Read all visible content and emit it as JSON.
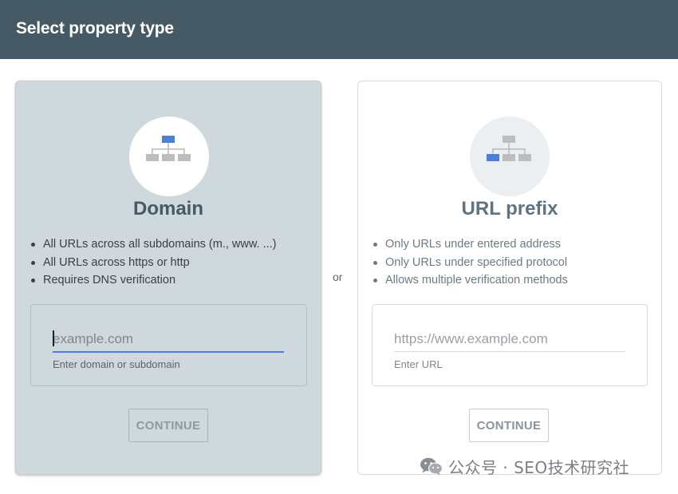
{
  "header": {
    "title": "Select property type"
  },
  "separator": "or",
  "domain_card": {
    "icon": "domain-network-icon",
    "title": "Domain",
    "bullets": [
      "All URLs across all subdomains (m., www. ...)",
      "All URLs across https or http",
      "Requires DNS verification"
    ],
    "input": {
      "placeholder": "example.com",
      "value": "",
      "helper": "Enter domain or subdomain"
    },
    "continue_label": "CONTINUE"
  },
  "url_card": {
    "icon": "url-prefix-network-icon",
    "title": "URL prefix",
    "bullets": [
      "Only URLs under entered address",
      "Only URLs under specified protocol",
      "Allows multiple verification methods"
    ],
    "input": {
      "placeholder": "https://www.example.com",
      "value": "",
      "helper": "Enter URL"
    },
    "continue_label": "CONTINUE"
  },
  "watermark": {
    "icon": "wechat-icon",
    "text": "公众号 · SEO技术研究社"
  },
  "colors": {
    "header_bg": "#455a64",
    "selected_card_bg": "#cfd8dc",
    "accent_blue": "#4a80d9",
    "icon_gray": "#bdbdbd"
  }
}
